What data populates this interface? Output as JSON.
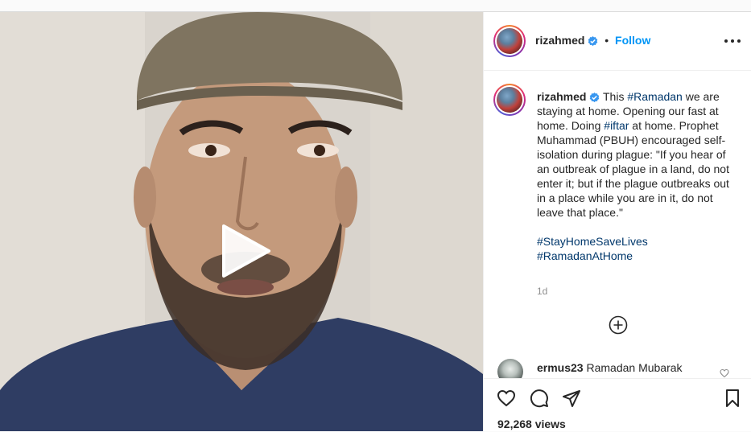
{
  "post": {
    "username": "rizahmed",
    "follow_label": "Follow",
    "separator": "•",
    "verified_icon": "verified-badge-icon",
    "accent_color": "#0095f6",
    "link_color": "#00376b"
  },
  "caption": {
    "username": "rizahmed",
    "t1": "This ",
    "tag1": "#Ramadan",
    "t2": " we are staying at home. Opening our fast at home. Doing ",
    "tag2": "#iftar",
    "t3": " at home. Prophet Muhammad (PBUH) encouraged self-isolation during plague: \"If you hear of an outbreak of plague in a land, do not enter it; but if the plague outbreaks out in a place while you are in it, do not leave that place.\"",
    "hashtag_a": "#StayHomeSaveLives",
    "hashtag_b": "#RamadanAtHome",
    "time": "1d"
  },
  "comments": [
    {
      "username": "ermus23",
      "text": "Ramadan Mubarak"
    }
  ],
  "actions": {
    "icons": [
      "heart-icon",
      "comment-icon",
      "share-icon",
      "bookmark-icon"
    ],
    "views": "92,268 views"
  },
  "video": {
    "state": "paused",
    "icon": "play-icon"
  }
}
